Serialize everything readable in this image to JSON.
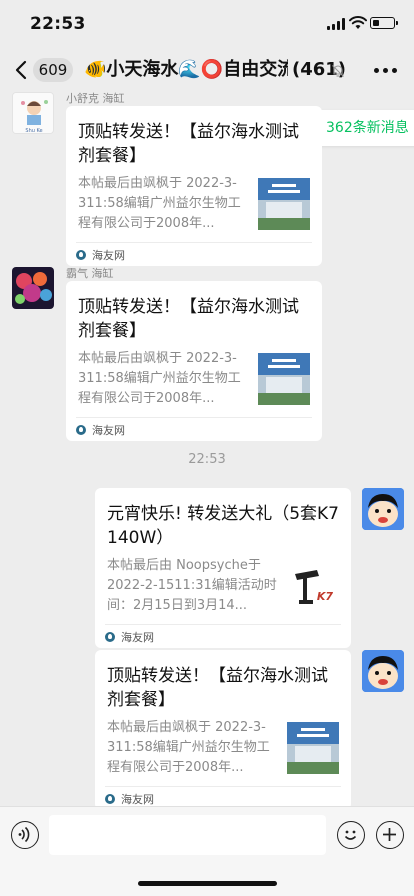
{
  "status_bar": {
    "time": "22:53",
    "battery_level": 0.35
  },
  "nav": {
    "unread_count": "609",
    "title": "🐠小天海水🌊⭕自由交流群",
    "member_count": "(461)"
  },
  "new_messages_pill": "362条新消息",
  "messages": [
    {
      "sender": "小舒克 海缸",
      "card": {
        "title": "顶贴转发送！【益尔海水测试剂套餐】",
        "desc": "本帖最后由飒枫于 2022-3-311:58编辑广州益尔生物工程有限公司于2008年...",
        "source": "海友网"
      }
    },
    {
      "sender": "霸气 海缸",
      "card": {
        "title": "顶贴转发送！【益尔海水测试剂套餐】",
        "desc": "本帖最后由飒枫于 2022-3-311:58编辑广州益尔生物工程有限公司于2008年...",
        "source": "海友网"
      }
    },
    {
      "sender": "",
      "card": {
        "title": "元宵快乐! 转发送大礼（5套K7 140W）",
        "desc": "本帖最后由 Noopsyche于2022-2-1511:31编辑活动时间：2月15日到3月14...",
        "source": "海友网"
      }
    },
    {
      "sender": "",
      "card": {
        "title": "顶贴转发送！【益尔海水测试剂套餐】",
        "desc": "本帖最后由飒枫于 2022-3-311:58编辑广州益尔生物工程有限公司于2008年...",
        "source": "海友网"
      }
    }
  ],
  "time_divider": "22:53",
  "colors": {
    "accent": "#07c160",
    "background": "#ededed",
    "card": "#ffffff"
  },
  "icons": {
    "back": "chevron-left-icon",
    "mute": "bell-off-icon",
    "more": "more-dots-icon",
    "voice": "voice-icon",
    "emoji": "emoji-icon",
    "plus": "plus-icon"
  }
}
